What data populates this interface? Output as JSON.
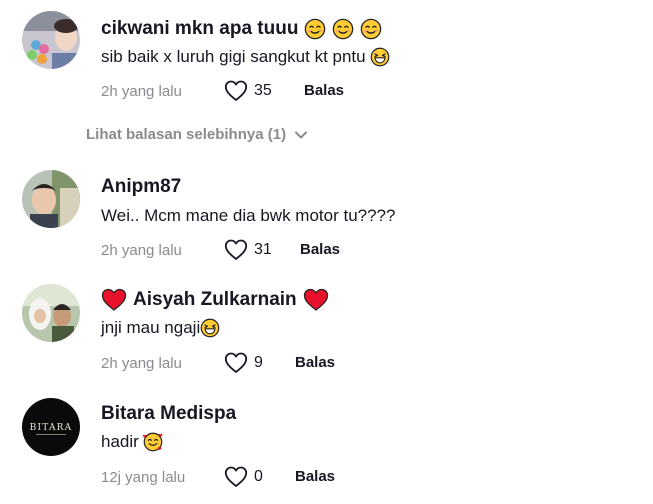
{
  "comments": [
    {
      "username": "cikwani mkn apa tuuu",
      "text": "sib baik x luruh gigi sangkut kt pntu",
      "time": "2h yang lalu",
      "likes": "35",
      "reply_label": "Balas",
      "emojis": [
        "smiling-face-icon",
        "smiling-face-icon",
        "smiling-face-icon"
      ],
      "text_emoji": "grinning-sweat-face-icon"
    },
    {
      "username": "Anipm87",
      "text": "Wei.. Mcm mane dia bwk motor tu????",
      "time": "2h yang lalu",
      "likes": "31",
      "reply_label": "Balas"
    },
    {
      "username": "Aisyah Zulkarnain",
      "text": "jnji mau ngaji",
      "time": "2h yang lalu",
      "likes": "9",
      "reply_label": "Balas",
      "emojis": [
        "red-heart-icon",
        "red-heart-icon"
      ],
      "text_emoji": "grinning-sweat-face-icon"
    },
    {
      "username": "Bitara Medispa",
      "text": "hadir",
      "time": "12j yang lalu",
      "likes": "0",
      "reply_label": "Balas",
      "avatar_text": "BITARA",
      "text_emoji": "smiling-hearts-face-icon"
    }
  ],
  "more_replies": {
    "label": "Lihat balasan selebihnya (1)"
  },
  "colors": {
    "text": "#161823",
    "muted": "#8a8b91",
    "heart": "#e8102a",
    "emoji_yellow": "#ffcc33"
  }
}
